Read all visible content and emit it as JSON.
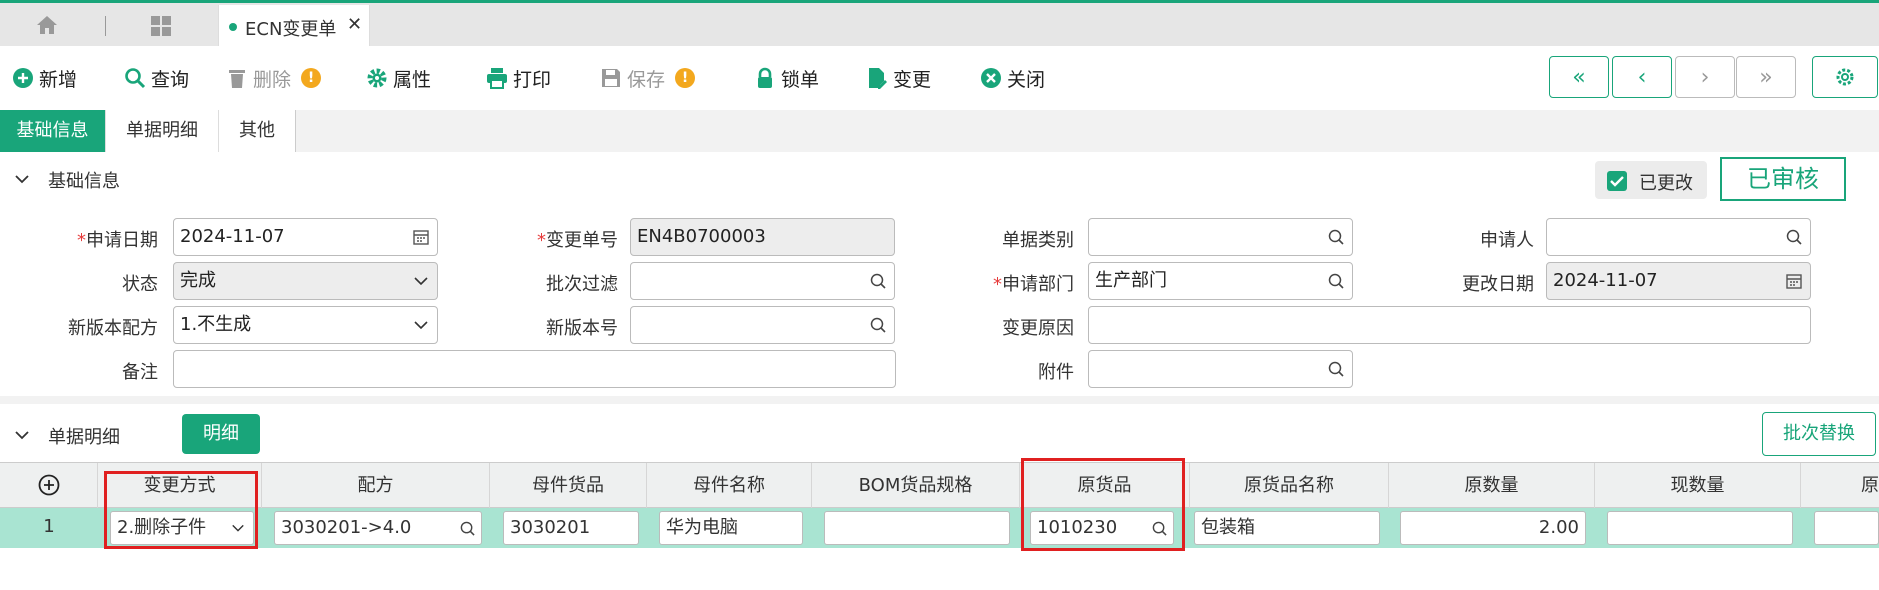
{
  "tabbar": {
    "home_icon": "home-icon",
    "apps_icon": "grid-icon",
    "active_tab": "ECN变更单",
    "close": "✕"
  },
  "toolbar": {
    "add": "新增",
    "query": "查询",
    "delete": "删除",
    "properties": "属性",
    "print": "打印",
    "save": "保存",
    "lock": "锁单",
    "change": "变更",
    "close": "关闭",
    "warn": "!"
  },
  "nav": {
    "first": "«",
    "prev": "‹",
    "next": "›",
    "last": "»"
  },
  "section_tabs": [
    "基础信息",
    "单据明细",
    "其他"
  ],
  "basic": {
    "title": "基础信息",
    "modified_label": "已更改",
    "status_stamp": "已审核",
    "fields": {
      "apply_date_label": "申请日期",
      "apply_date": "2024-11-07",
      "change_no_label": "变更单号",
      "change_no": "EN4B0700003",
      "doc_type_label": "单据类别",
      "doc_type": "",
      "applicant_label": "申请人",
      "applicant": "",
      "status_label": "状态",
      "status": "完成",
      "batch_filter_label": "批次过滤",
      "batch_filter": "",
      "dept_label": "申请部门",
      "dept": "生产部门",
      "modify_date_label": "更改日期",
      "modify_date": "2024-11-07",
      "new_formula_label": "新版本配方",
      "new_formula": "1.不生成",
      "new_version_label": "新版本号",
      "new_version": "",
      "change_reason_label": "变更原因",
      "change_reason": "",
      "remark_label": "备注",
      "remark": "",
      "attachment_label": "附件",
      "attachment": ""
    }
  },
  "detail": {
    "title": "单据明细",
    "detail_btn": "明细",
    "batch_replace": "批次替换",
    "add_icon": "⊕",
    "columns": [
      "变更方式",
      "配方",
      "母件货品",
      "母件名称",
      "BOM货品规格",
      "原货品",
      "原货品名称",
      "原数量",
      "现数量",
      "原"
    ],
    "row": {
      "index": "1",
      "change_method": "2.删除子件",
      "formula": "3030201->4.0",
      "parent_item": "3030201",
      "parent_name": "华为电脑",
      "bom_spec": "",
      "orig_item": "1010230",
      "orig_item_name": "包装箱",
      "orig_qty": "2.00",
      "curr_qty": ""
    }
  },
  "colors": {
    "accent": "#19a57a",
    "row_highlight": "#a9e4d2",
    "highlight_box": "#e02020",
    "warn": "#f3a81e"
  }
}
